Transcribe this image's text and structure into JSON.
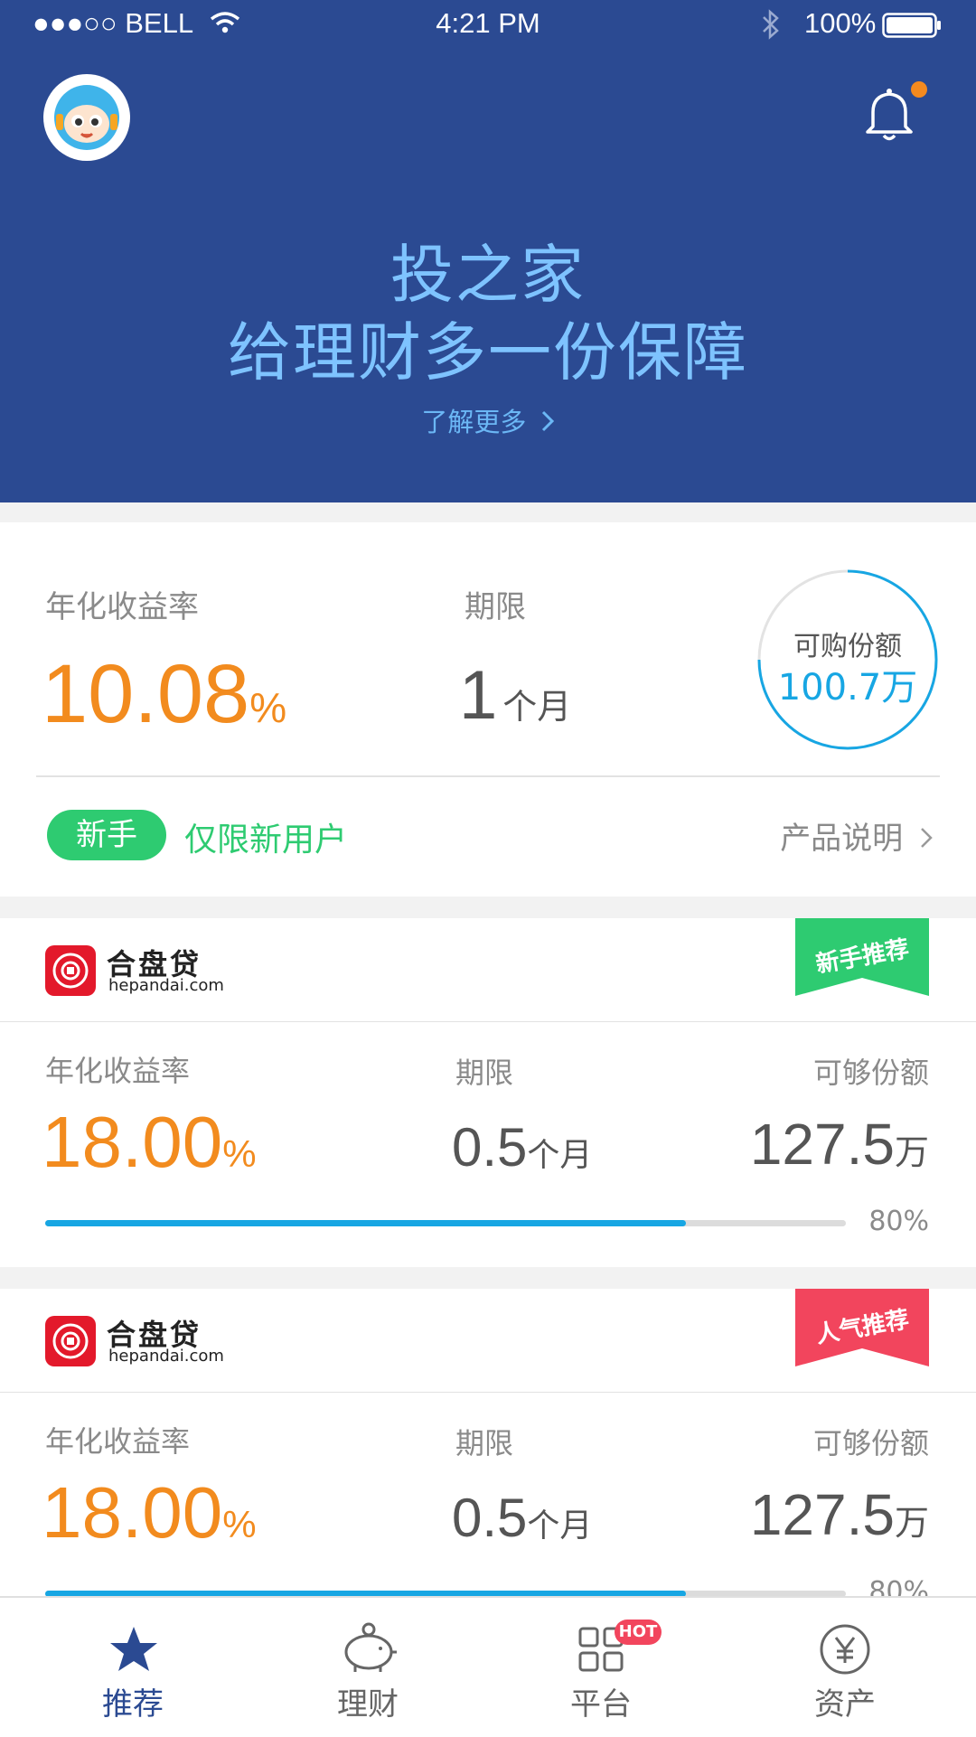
{
  "status_bar": {
    "carrier": "●●●○○ BELL",
    "time": "4:21 PM",
    "battery": "100%"
  },
  "hero": {
    "title_line1": "投之家",
    "title_line2": "给理财多一份保障",
    "learn_more": "了解更多"
  },
  "featured": {
    "rate_label": "年化收益率",
    "rate_value": "10.08",
    "rate_unit": "%",
    "term_label": "期限",
    "term_value": "1",
    "term_unit": "个月",
    "quota_label": "可购份额",
    "quota_value": "100.7万",
    "badge": "新手",
    "badge_note": "仅限新用户",
    "product_link": "产品说明"
  },
  "products": [
    {
      "brand_name": "合盘贷",
      "brand_domain": "hepandai.com",
      "ribbon": "新手推荐",
      "ribbon_color": "#2ecb71",
      "rate_label": "年化收益率",
      "rate_value": "18.00",
      "rate_unit": "%",
      "term_label": "期限",
      "term_value": "0.5",
      "term_unit": "个月",
      "quota_label": "可够份额",
      "quota_value": "127.5",
      "quota_unit": "万",
      "progress": 80,
      "progress_text": "80%"
    },
    {
      "brand_name": "合盘贷",
      "brand_domain": "hepandai.com",
      "ribbon": "人气推荐",
      "ribbon_color": "#f2455d",
      "rate_label": "年化收益率",
      "rate_value": "18.00",
      "rate_unit": "%",
      "term_label": "期限",
      "term_value": "0.5",
      "term_unit": "个月",
      "quota_label": "可够份额",
      "quota_value": "127.5",
      "quota_unit": "万",
      "progress": 80,
      "progress_text": "80%"
    }
  ],
  "tabbar": {
    "items": [
      {
        "label": "推荐",
        "icon": "star-icon",
        "active": true
      },
      {
        "label": "理财",
        "icon": "piggy-bank-icon",
        "active": false
      },
      {
        "label": "平台",
        "icon": "grid-icon",
        "active": false,
        "badge": "HOT"
      },
      {
        "label": "资产",
        "icon": "yen-icon",
        "active": false
      }
    ]
  },
  "colors": {
    "header": "#2b4a92",
    "accent_orange": "#f28b1e",
    "accent_blue": "#17a6e3",
    "active_tab": "#2b4a92"
  }
}
